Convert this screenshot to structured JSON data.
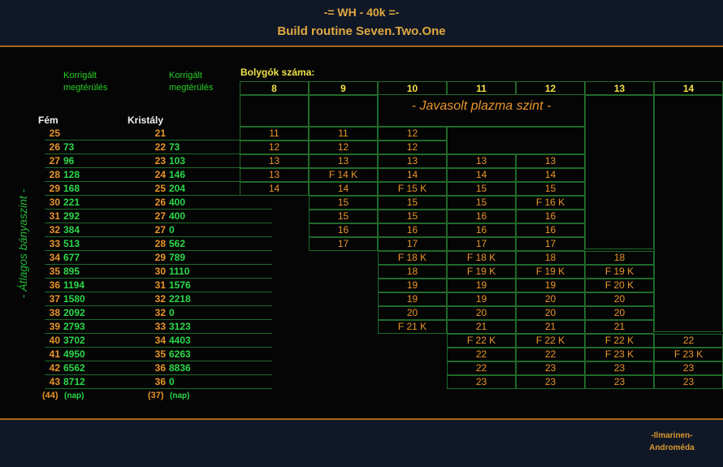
{
  "header": {
    "title": "-= WH - 40k =-",
    "subtitle": "Build routine Seven.Two.One"
  },
  "footer": {
    "author": "-Ilmarinen-",
    "location": "Androméda"
  },
  "labels": {
    "korrigalt": "Korrigált",
    "megterules": "megtérülés",
    "fem": "Fém",
    "kristaly": "Kristály",
    "bolygok": "Bolygók száma:",
    "javasolt": "- Javasolt plazma szint -",
    "atlagos": "- Átlagos bányaszint -",
    "nap": "(nap)",
    "fem_avg": "(44)",
    "kristaly_avg": "(37)"
  },
  "planet_columns": [
    "8",
    "9",
    "10",
    "11",
    "12",
    "13",
    "14"
  ],
  "rows": [
    {
      "f1": "25",
      "f2": "",
      "k1": "21",
      "k2": "",
      "cells": [
        "11",
        "11",
        "12",
        "",
        "",
        "",
        ""
      ]
    },
    {
      "f1": "26",
      "f2": "73",
      "k1": "22",
      "k2": "73",
      "cells": [
        "12",
        "12",
        "12",
        "",
        "",
        "",
        ""
      ]
    },
    {
      "f1": "27",
      "f2": "96",
      "k1": "23",
      "k2": "103",
      "cells": [
        "13",
        "13",
        "13",
        "13",
        "13",
        "",
        ""
      ]
    },
    {
      "f1": "28",
      "f2": "128",
      "k1": "24",
      "k2": "146",
      "cells": [
        "13",
        "F 14 K",
        "14",
        "14",
        "14",
        "",
        ""
      ]
    },
    {
      "f1": "29",
      "f2": "168",
      "k1": "25",
      "k2": "204",
      "cells": [
        "14",
        "14",
        "F 15 K",
        "15",
        "15",
        "",
        ""
      ]
    },
    {
      "f1": "30",
      "f2": "221",
      "k1": "26",
      "k2": "400",
      "cells": [
        "",
        "15",
        "15",
        "15",
        "F 16 K",
        "",
        ""
      ]
    },
    {
      "f1": "31",
      "f2": "292",
      "k1": "27",
      "k2": "400",
      "cells": [
        "",
        "15",
        "15",
        "16",
        "16",
        "",
        ""
      ]
    },
    {
      "f1": "32",
      "f2": "384",
      "k1": "27",
      "k2": "0",
      "cells": [
        "",
        "16",
        "16",
        "16",
        "16",
        "",
        ""
      ]
    },
    {
      "f1": "33",
      "f2": "513",
      "k1": "28",
      "k2": "562",
      "cells": [
        "",
        "17",
        "17",
        "17",
        "17",
        "",
        ""
      ]
    },
    {
      "f1": "34",
      "f2": "677",
      "k1": "29",
      "k2": "789",
      "cells": [
        "",
        "",
        "F 18 K",
        "F 18 K",
        "18",
        "18",
        ""
      ]
    },
    {
      "f1": "35",
      "f2": "895",
      "k1": "30",
      "k2": "1110",
      "cells": [
        "",
        "",
        "18",
        "F 19 K",
        "F 19 K",
        "F 19 K",
        ""
      ]
    },
    {
      "f1": "36",
      "f2": "1194",
      "k1": "31",
      "k2": "1576",
      "cells": [
        "",
        "",
        "19",
        "19",
        "19",
        "F 20 K",
        ""
      ]
    },
    {
      "f1": "37",
      "f2": "1580",
      "k1": "32",
      "k2": "2218",
      "cells": [
        "",
        "",
        "19",
        "19",
        "20",
        "20",
        ""
      ]
    },
    {
      "f1": "38",
      "f2": "2092",
      "k1": "32",
      "k2": "0",
      "cells": [
        "",
        "",
        "20",
        "20",
        "20",
        "20",
        ""
      ]
    },
    {
      "f1": "39",
      "f2": "2793",
      "k1": "33",
      "k2": "3123",
      "cells": [
        "",
        "",
        "F 21 K",
        "21",
        "21",
        "21",
        ""
      ]
    },
    {
      "f1": "40",
      "f2": "3702",
      "k1": "34",
      "k2": "4403",
      "cells": [
        "",
        "",
        "",
        "F 22 K",
        "F 22 K",
        "F 22 K",
        "22"
      ]
    },
    {
      "f1": "41",
      "f2": "4950",
      "k1": "35",
      "k2": "6263",
      "cells": [
        "",
        "",
        "",
        "22",
        "22",
        "F 23 K",
        "F 23 K"
      ]
    },
    {
      "f1": "42",
      "f2": "6562",
      "k1": "36",
      "k2": "8836",
      "cells": [
        "",
        "",
        "",
        "22",
        "23",
        "23",
        "23"
      ]
    },
    {
      "f1": "43",
      "f2": "8712",
      "k1": "36",
      "k2": "0",
      "cells": [
        "",
        "",
        "",
        "23",
        "23",
        "23",
        "23"
      ]
    }
  ]
}
